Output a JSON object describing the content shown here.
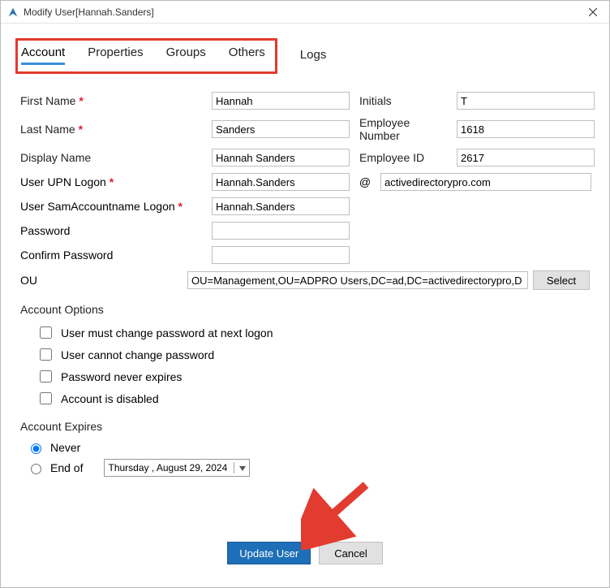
{
  "title": "Modify User[Hannah.Sanders]",
  "tabs": {
    "account": "Account",
    "properties": "Properties",
    "groups": "Groups",
    "others": "Others",
    "logs": "Logs"
  },
  "labels": {
    "firstName": "First Name",
    "lastName": "Last Name",
    "displayName": "Display Name",
    "userUpn": "User UPN Logon",
    "userSam": "User SamAccountname Logon",
    "password": "Password",
    "confirmPassword": "Confirm Password",
    "ou": "OU",
    "initials": "Initials",
    "employeeNumber": "Employee Number",
    "employeeId": "Employee ID",
    "at": "@",
    "accountOptions": "Account Options",
    "optMustChange": "User must change password at next logon",
    "optCannotChange": "User cannot change password",
    "optNeverExpires": "Password never expires",
    "optDisabled": "Account is disabled",
    "accountExpires": "Account Expires",
    "never": "Never",
    "endOf": "End of",
    "select": "Select",
    "update": "Update User",
    "cancel": "Cancel"
  },
  "values": {
    "firstName": "Hannah",
    "lastName": "Sanders",
    "displayName": "Hannah Sanders",
    "upn": "Hannah.Sanders",
    "upnDomain": "activedirectorypro.com",
    "sam": "Hannah.Sanders",
    "initials": "T",
    "employeeNumber": "1618",
    "employeeId": "2617",
    "ou": "OU=Management,OU=ADPRO Users,DC=ad,DC=activedirectorypro,D",
    "expireDate": "Thursday ,   August   29, 2024"
  }
}
